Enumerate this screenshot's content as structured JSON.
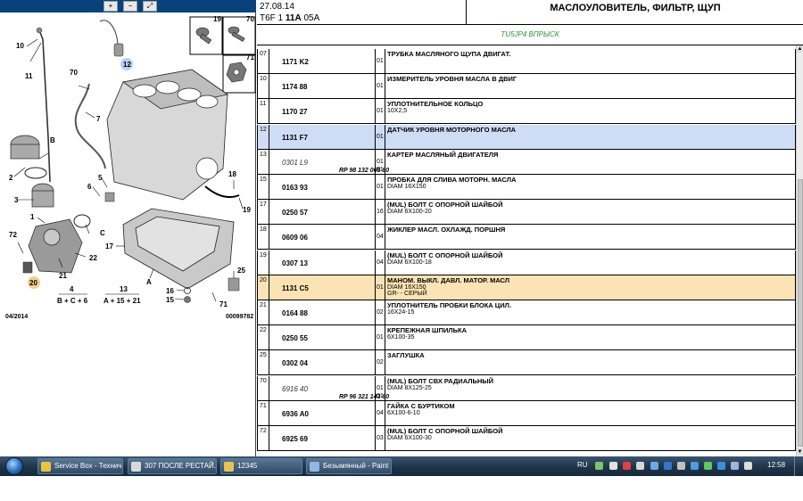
{
  "zoom_buttons": [
    "+",
    "−",
    "⤢"
  ],
  "diagram": {
    "date": "04/2014",
    "code": "00099782",
    "callouts": [
      "19",
      "70",
      "71",
      "10",
      "11",
      "12",
      "70",
      "7",
      "B",
      "2",
      "3",
      "1",
      "5",
      "6",
      "C",
      "18",
      "19",
      "72",
      "20",
      "22",
      "21",
      "4",
      "B + C + 6",
      "13",
      "A + 15 + 21",
      "17",
      "A",
      "25",
      "16",
      "15",
      "71"
    ]
  },
  "header": {
    "date": "27.08.14",
    "code_prefix": "T6F 1 ",
    "code_bold": "11A",
    "code_suffix": " 05A",
    "title": "МАСЛОУЛОВИТЕЛЬ, ФИЛЬТР, ЩУП",
    "engine": "TU5JP4 ВПРЫСК"
  },
  "rows": [
    {
      "ref": "07",
      "part": "1171 K2",
      "alt": false,
      "rp": "",
      "qty": "01",
      "qty2": "",
      "name": "ТРУБКА МАСЛЯНОГО ЩУПА ДВИГАТ.",
      "note": "",
      "note2": "",
      "state": ""
    },
    {
      "ref": "10",
      "part": "1174 88",
      "alt": false,
      "rp": "",
      "qty": "01",
      "qty2": "",
      "name": "ИЗМЕРИТЕЛЬ УРОВНЯ МАСЛА В ДВИГ",
      "note": "",
      "note2": "",
      "state": ""
    },
    {
      "ref": "11",
      "part": "1170 27",
      "alt": false,
      "rp": "",
      "qty": "01",
      "qty2": "",
      "name": "УПЛОТНИТЕЛЬНОЕ КОЛЬЦО",
      "note": "10X2,5",
      "note2": "",
      "state": ""
    },
    {
      "ref": "12",
      "part": "1131 F7",
      "alt": false,
      "rp": "",
      "qty": "01",
      "qty2": "",
      "name": "ДАТЧИК УРОВНЯ МОТОРНОГО МАСЛА",
      "note": "",
      "note2": "",
      "state": "sel"
    },
    {
      "ref": "13",
      "part": "0301 L9",
      "alt": true,
      "rp": "RP 98 132 065 80",
      "qty": "01",
      "qty2": "01",
      "name": "КАРТЕР МАСЛЯНЫЙ ДВИГАТЕЛЯ",
      "note": "",
      "note2": "",
      "state": ""
    },
    {
      "ref": "15",
      "part": "0163 93",
      "alt": false,
      "rp": "",
      "qty": "01",
      "qty2": "",
      "name": "ПРОБКА ДЛЯ СЛИВА МОТОРН. МАСЛА",
      "note": "DIAM 16X150",
      "note2": "",
      "state": ""
    },
    {
      "ref": "17",
      "part": "0250 57",
      "alt": false,
      "rp": "",
      "qty": "16",
      "qty2": "",
      "name": "(MUL) БОЛТ С ОПОРНОЙ ШАЙБОЙ",
      "note": "DIAM 6X100-20",
      "note2": "",
      "state": ""
    },
    {
      "ref": "18",
      "part": "0609 06",
      "alt": false,
      "rp": "",
      "qty": "04",
      "qty2": "",
      "name": "ЖИКЛЕР МАСЛ. ОХЛАЖД. ПОРШНЯ",
      "note": "",
      "note2": "",
      "state": ""
    },
    {
      "ref": "19",
      "part": "0307 13",
      "alt": false,
      "rp": "",
      "qty": "04",
      "qty2": "",
      "name": "(MUL) БОЛТ С ОПОРНОЙ ШАЙБОЙ",
      "note": "DIAM 6X100-18",
      "note2": "",
      "state": ""
    },
    {
      "ref": "20",
      "part": "1131 C5",
      "alt": false,
      "rp": "",
      "qty": "01",
      "qty2": "",
      "name": "МАНОМ. ВЫКЛ. ДАВЛ. МАТОР. МАСЛ",
      "note": "DIAM 16X150",
      "note2": "GR- - СЕРЫЙ",
      "state": "hl"
    },
    {
      "ref": "21",
      "part": "0164 88",
      "alt": false,
      "rp": "",
      "qty": "02",
      "qty2": "",
      "name": "УПЛОТНИТЕЛЬ ПРОБКИ БЛОКА ЦИЛ.",
      "note": "16X24-15",
      "note2": "",
      "state": ""
    },
    {
      "ref": "22",
      "part": "0250 55",
      "alt": false,
      "rp": "",
      "qty": "01",
      "qty2": "",
      "name": "КРЕПЕЖНАЯ ШПИЛЬКА",
      "note": "6X100-35",
      "note2": "",
      "state": ""
    },
    {
      "ref": "25",
      "part": "0302 04",
      "alt": false,
      "rp": "",
      "qty": "02",
      "qty2": "",
      "name": "ЗАГЛУШКА",
      "note": "",
      "note2": "",
      "state": ""
    },
    {
      "ref": "70",
      "part": "6916 40",
      "alt": true,
      "rp": "RP 96 321 143 80",
      "qty": "01",
      "qty2": "01",
      "name": "(MUL) БОЛТ СВХ РАДИАЛЬНЫЙ",
      "note": "DIAM 8X125-25",
      "note2": "",
      "state": ""
    },
    {
      "ref": "71",
      "part": "6936 A0",
      "alt": false,
      "rp": "",
      "qty": "04",
      "qty2": "",
      "name": "ГАЙКА С БУРТИКОМ",
      "note": "6X100-6-10",
      "note2": "",
      "state": ""
    },
    {
      "ref": "72",
      "part": "6925 69",
      "alt": false,
      "rp": "",
      "qty": "03",
      "qty2": "",
      "name": "(MUL) БОЛТ С ОПОРНОЙ ШАЙБОЙ",
      "note": "DIAM 6X100-30",
      "note2": "",
      "state": ""
    }
  ],
  "taskbar": {
    "tasks": [
      {
        "label": "Service Box - Технич...",
        "icon": "chrome-icon",
        "color": "#e9c440"
      },
      {
        "label": "307 ПОСЛЕ РЕСТАЙ...",
        "icon": "document-icon",
        "color": "#d9d9d9"
      },
      {
        "label": "12345",
        "icon": "folder-icon",
        "color": "#e8c15a"
      },
      {
        "label": "Безымянный - Paint",
        "icon": "paint-icon",
        "color": "#8fb7e0"
      }
    ],
    "language": "RU",
    "clock": "12:58"
  }
}
